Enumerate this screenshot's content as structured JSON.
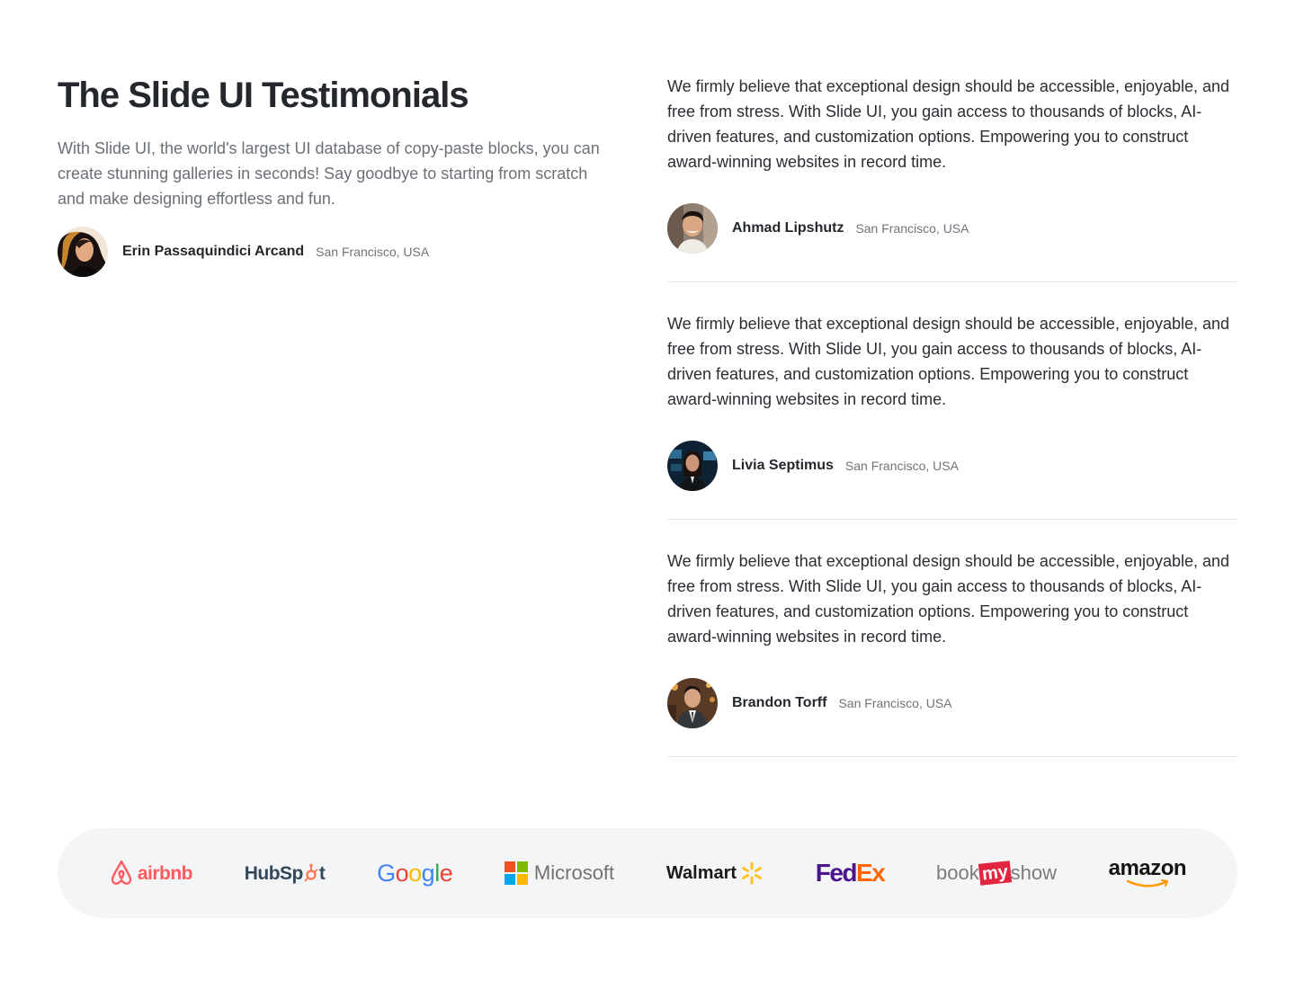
{
  "header": {
    "title": "The Slide UI Testimonials",
    "subtitle": "With Slide UI, the world's largest UI database of copy-paste blocks, you can create stunning galleries in seconds! Say goodbye to starting from scratch and make designing effortless and fun."
  },
  "featured": {
    "name": "Erin Passaquindici Arcand",
    "location": "San Francisco, USA",
    "avatar_icon": "avatar-woman-icon"
  },
  "testimonials": [
    {
      "quote": "We firmly believe that exceptional design should be accessible, enjoyable, and free from stress. With Slide UI, you gain access to thousands of blocks, AI-driven features, and customization options. Empowering you to construct award-winning websites in record time.",
      "name": "Ahmad Lipshutz",
      "location": "San Francisco, USA"
    },
    {
      "quote": "We firmly believe that exceptional design should be accessible, enjoyable, and free from stress. With Slide UI, you gain access to thousands of blocks, AI-driven features, and customization options. Empowering you to construct award-winning websites in record time.",
      "name": "Livia Septimus",
      "location": "San Francisco, USA"
    },
    {
      "quote": "We firmly believe that exceptional design should be accessible, enjoyable, and free from stress. With Slide UI, you gain access to thousands of blocks, AI-driven features, and customization options. Empowering you to construct award-winning websites in record time.",
      "name": "Brandon Torff",
      "location": "San Francisco, USA"
    }
  ],
  "logos": {
    "airbnb": "airbnb",
    "hubspot_a": "HubSp",
    "hubspot_b": "t",
    "google": [
      "G",
      "o",
      "o",
      "g",
      "l",
      "e"
    ],
    "microsoft": "Microsoft",
    "walmart": "Walmart",
    "fedex_a": "Fed",
    "fedex_b": "Ex",
    "bms_a": "book",
    "bms_b": "my",
    "bms_c": "show",
    "amazon": "amazon"
  },
  "colors": {
    "background": "#ffffff",
    "strip": "#f4f5f7",
    "airbnb": "#ff5a5f",
    "hubspot_sprocket": "#ff7a59",
    "fedex_purple": "#4d148c",
    "fedex_orange": "#ff6600",
    "walmart_spark": "#ffc220",
    "bms_red": "#e3263f",
    "amazon_orange": "#ff9900"
  }
}
